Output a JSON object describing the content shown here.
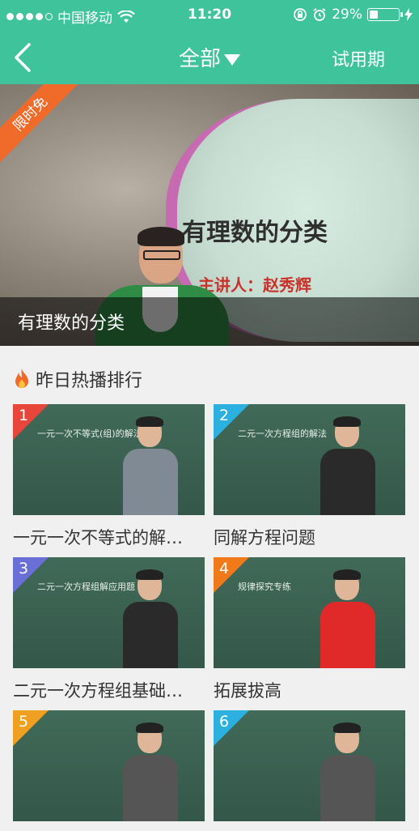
{
  "status_bar": {
    "carrier": "中国移动",
    "time": "11:20",
    "battery_text": "29%",
    "battery_level": 0.29,
    "signal_bars_filled": 4,
    "signal_bars_total": 5
  },
  "nav": {
    "title": "全部",
    "right_label": "试用期"
  },
  "banner": {
    "badge": "限时免",
    "slide_title": "有理数的分类",
    "slide_subtitle": "主讲人：赵秀辉",
    "caption": "有理数的分类"
  },
  "section": {
    "title": "昨日热播排行"
  },
  "ranking": [
    {
      "rank": "1",
      "title": "一元一次不等式的解…",
      "board_text": "一元一次不等式(组)的解法",
      "tag_color": "#e8463a"
    },
    {
      "rank": "2",
      "title": "同解方程问题",
      "board_text": "二元一次方程组的解法",
      "tag_color": "#2bb0e0"
    },
    {
      "rank": "3",
      "title": "二元一次方程组基础…",
      "board_text": "二元一次方程组解应用题",
      "tag_color": "#6a6fd8"
    },
    {
      "rank": "4",
      "title": "拓展拔高",
      "board_text": "规律探究专练",
      "tag_color": "#f07a1a"
    },
    {
      "rank": "5",
      "title": "",
      "board_text": "",
      "tag_color": "#f0a020"
    },
    {
      "rank": "6",
      "title": "",
      "board_text": "",
      "tag_color": "#2bb0e0"
    }
  ],
  "colors": {
    "accent": "#3ec39a"
  }
}
